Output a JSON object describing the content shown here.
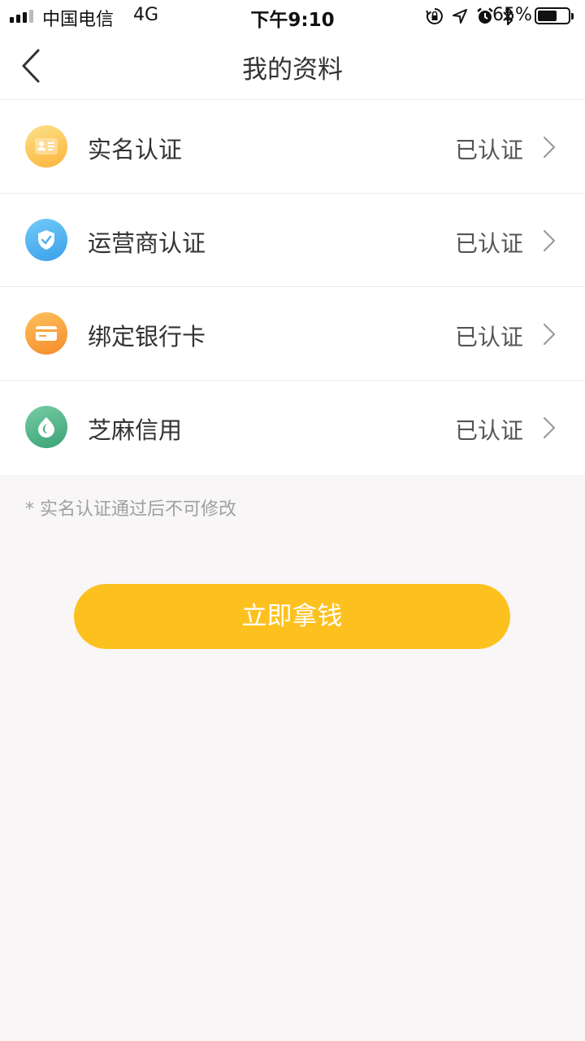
{
  "status_bar": {
    "carrier": "中国电信",
    "network": "4G",
    "time": "下午9:10",
    "battery_percent": "65%",
    "battery_level": 0.65,
    "icons": [
      "orientation-lock-icon",
      "location-icon",
      "alarm-icon",
      "bluetooth-icon"
    ]
  },
  "nav": {
    "title": "我的资料",
    "back_icon": "back-chevron-icon"
  },
  "items": [
    {
      "label": "实名认证",
      "status": "已认证",
      "icon": "id-card-icon",
      "icon_colors": [
        "#fdd77a",
        "#fbb93c"
      ]
    },
    {
      "label": "运营商认证",
      "status": "已认证",
      "icon": "shield-icon",
      "icon_colors": [
        "#6ac6f7",
        "#3aa4ec"
      ]
    },
    {
      "label": "绑定银行卡",
      "status": "已认证",
      "icon": "bank-card-icon",
      "icon_colors": [
        "#fdbb55",
        "#f78f2f"
      ]
    },
    {
      "label": "芝麻信用",
      "status": "已认证",
      "icon": "sesame-credit-icon",
      "icon_colors": [
        "#6cc59c",
        "#3ea57a"
      ]
    }
  ],
  "note": "* 实名认证通过后不可修改",
  "cta": {
    "label": "立即拿钱",
    "color": "#fdc11f"
  }
}
